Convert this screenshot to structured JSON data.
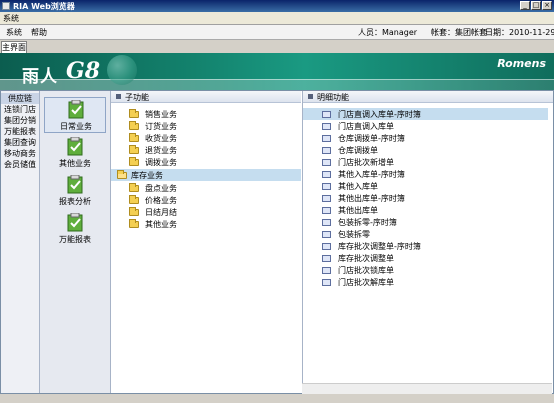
{
  "window": {
    "title": "RIA Web浏览器"
  },
  "menu": {
    "items": [
      "系统"
    ]
  },
  "appmenu": {
    "items": [
      "系统",
      "帮助"
    ]
  },
  "info": {
    "user": "人员：Manager",
    "account": "帐套：集团帐套",
    "date": "日期：2010-11-29"
  },
  "tabs": {
    "main": "主界面"
  },
  "banner": {
    "name_cn": "雨人",
    "name_g8": "G8",
    "brand": "Romens"
  },
  "leftnav": {
    "header": "供应链",
    "items": [
      "连锁门店",
      "集团分销",
      "万能报表",
      "集团查询",
      "移动商务",
      "会员储值"
    ]
  },
  "modules": {
    "items": [
      "日常业务",
      "其他业务",
      "报表分析",
      "万能报表"
    ],
    "active": "日常业务"
  },
  "subpanel": {
    "title": "子功能",
    "items": [
      "销售业务",
      "订货业务",
      "收货业务",
      "退货业务",
      "调拨业务",
      "库存业务",
      "盘点业务",
      "价格业务",
      "日结月结",
      "其他业务"
    ],
    "selected": "库存业务"
  },
  "detailpanel": {
    "title": "明细功能",
    "items": [
      "门店直调入库单-序时簿",
      "门店直调入库单",
      "仓库调拨单-序时簿",
      "仓库调拨单",
      "门店批次新增单",
      "其他入库单-序时簿",
      "其他入库单",
      "其他出库单-序时簿",
      "其他出库单",
      "包装拆零-序时簿",
      "包装拆零",
      "库存批次调整单-序时簿",
      "库存批次调整单",
      "门店批次锁库单",
      "门店批次解库单"
    ],
    "selected": "门店直调入库单-序时簿"
  },
  "colors": {
    "banner": "#13826d",
    "selection": "#c5ddef",
    "titlebar": "#0a246a"
  },
  "icons": {
    "folder": "folder-icon",
    "document": "document-icon",
    "module": "module-icon"
  }
}
